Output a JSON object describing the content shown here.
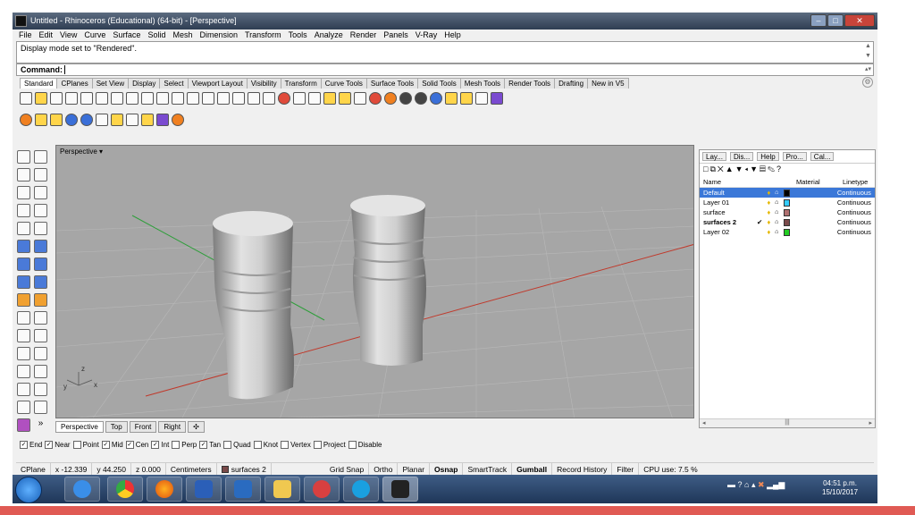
{
  "window": {
    "title": "Untitled - Rhinoceros (Educational) (64-bit) - [Perspective]"
  },
  "menu": [
    "File",
    "Edit",
    "View",
    "Curve",
    "Surface",
    "Solid",
    "Mesh",
    "Dimension",
    "Transform",
    "Tools",
    "Analyze",
    "Render",
    "Panels",
    "V-Ray",
    "Help"
  ],
  "history": {
    "line": "Display mode set to \"Rendered\"."
  },
  "command": {
    "label": "Command:",
    "value": ""
  },
  "toolbar_tabs": [
    "Standard",
    "CPlanes",
    "Set View",
    "Display",
    "Select",
    "Viewport Layout",
    "Visibility",
    "Transform",
    "Curve Tools",
    "Surface Tools",
    "Solid Tools",
    "Mesh Tools",
    "Render Tools",
    "Drafting",
    "New in V5"
  ],
  "viewport": {
    "label": "Perspective",
    "tabs": [
      "Perspective",
      "Top",
      "Front",
      "Right"
    ],
    "axis_x": "x",
    "axis_y": "y",
    "axis_z": "z"
  },
  "panel": {
    "tabs": [
      "Lay...",
      "Dis...",
      "Help",
      "Pro...",
      "Cal..."
    ],
    "columns": {
      "name": "Name",
      "material": "Material",
      "linetype": "Linetype"
    },
    "layers": [
      {
        "name": "Default",
        "color": "#000000",
        "linetype": "Continuous",
        "current": false,
        "selected": true
      },
      {
        "name": "Layer 01",
        "color": "#33ccff",
        "linetype": "Continuous",
        "current": false,
        "selected": false
      },
      {
        "name": "surface",
        "color": "#b07070",
        "linetype": "Continuous",
        "current": false,
        "selected": false
      },
      {
        "name": "surfaces 2",
        "color": "#7a4a4a",
        "linetype": "Continuous",
        "current": true,
        "selected": false
      },
      {
        "name": "Layer 02",
        "color": "#22cc22",
        "linetype": "Continuous",
        "current": false,
        "selected": false
      }
    ]
  },
  "osnap": [
    {
      "label": "End",
      "checked": true
    },
    {
      "label": "Near",
      "checked": true
    },
    {
      "label": "Point",
      "checked": false
    },
    {
      "label": "Mid",
      "checked": true
    },
    {
      "label": "Cen",
      "checked": true
    },
    {
      "label": "Int",
      "checked": true
    },
    {
      "label": "Perp",
      "checked": false
    },
    {
      "label": "Tan",
      "checked": true
    },
    {
      "label": "Quad",
      "checked": false
    },
    {
      "label": "Knot",
      "checked": false
    },
    {
      "label": "Vertex",
      "checked": false
    },
    {
      "label": "Project",
      "checked": false
    },
    {
      "label": "Disable",
      "checked": false
    }
  ],
  "status": {
    "cplane": "CPlane",
    "x": "x -12.339",
    "y": "y 44.250",
    "z": "z 0.000",
    "units": "Centimeters",
    "layer": "surfaces 2",
    "grid_snap": "Grid Snap",
    "ortho": "Ortho",
    "planar": "Planar",
    "osnap": "Osnap",
    "smarttrack": "SmartTrack",
    "gumball": "Gumball",
    "record_history": "Record History",
    "filter": "Filter",
    "cpu": "CPU use: 7.5 %"
  },
  "taskbar": {
    "time": "04:51 p.m.",
    "date": "15/10/2017"
  },
  "colors": {
    "accent": "#3b78d8",
    "viewport_bg": "#a6a6a6",
    "grid_x": "#c0392b",
    "grid_y": "#2e9e3a"
  }
}
